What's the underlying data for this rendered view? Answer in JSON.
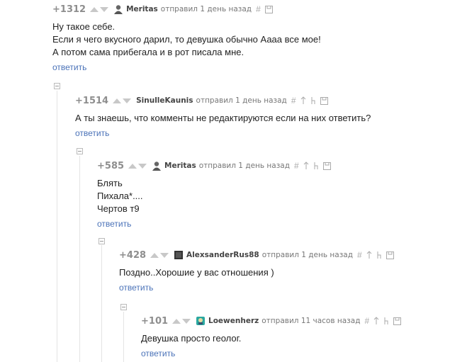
{
  "comments": [
    {
      "rating": "+1312",
      "author": "Meritas",
      "meta": "отправил 1 день назад",
      "lines": [
        "Ну такое себе.",
        "Если я чего вкусного дарил, то девушка обычно Аааа все мое!",
        "А потом сама прибегала и в рот писала мне."
      ],
      "reply": "ответить"
    },
    {
      "rating": "+1514",
      "author": "SinulleKaunis",
      "meta": "отправил 1 день назад",
      "lines": [
        "А ты знаешь, что комменты не редактируются если на них ответить?"
      ],
      "reply": "ответить"
    },
    {
      "rating": "+585",
      "author": "Meritas",
      "meta": "отправил 1 день назад",
      "lines": [
        "Блять",
        "Пихала*....",
        "Чертов т9"
      ],
      "reply": "ответить"
    },
    {
      "rating": "+428",
      "author": "AlexsanderRus88",
      "meta": "отправил 1 день назад",
      "lines": [
        "Поздно..Хорошие у вас отношения )"
      ],
      "reply": "ответить"
    },
    {
      "rating": "+101",
      "author": "Loewenherz",
      "meta": "отправил 11 часов назад",
      "lines": [
        "Девушка просто геолог."
      ],
      "reply": "ответить"
    }
  ],
  "icons": {
    "link": "#",
    "save": "save-icon",
    "parent": "to-parent-icon",
    "branch": "branch-icon"
  }
}
